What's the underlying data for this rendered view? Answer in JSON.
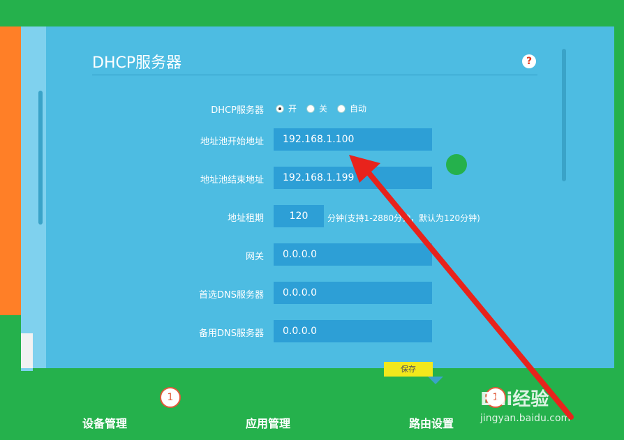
{
  "dhcp": {
    "title": "DHCP服务器",
    "help_icon": "?",
    "server_label": "DHCP服务器",
    "options": [
      "开",
      "关",
      "自动"
    ],
    "selected_option": "开",
    "start_label": "地址池开始地址",
    "start_value": "192.168.1.100",
    "end_label": "地址池结束地址",
    "end_value": "192.168.1.199",
    "lease_label": "地址租期",
    "lease_value": "120",
    "lease_hint": "分钟(支持1-2880分钟，默认为120分钟)",
    "gateway_label": "网关",
    "gateway_value": "0.0.0.0",
    "dns1_label": "首选DNS服务器",
    "dns1_value": "0.0.0.0",
    "dns2_label": "备用DNS服务器",
    "dns2_value": "0.0.0.0",
    "save_label": "保存"
  },
  "nav": {
    "items": [
      {
        "label": "设备管理",
        "badge": "1"
      },
      {
        "label": "应用管理",
        "badge": ""
      },
      {
        "label": "路由设置",
        "badge": "1"
      }
    ]
  },
  "watermark": {
    "brand": "Bai经验",
    "url": "jingyan.baidu.com"
  },
  "colors": {
    "panel": "#4dbce2",
    "field": "#2d9fd6",
    "annotation_arrow": "#e8231c",
    "save_button": "#f2e81c",
    "background_green": "#25b14c"
  }
}
